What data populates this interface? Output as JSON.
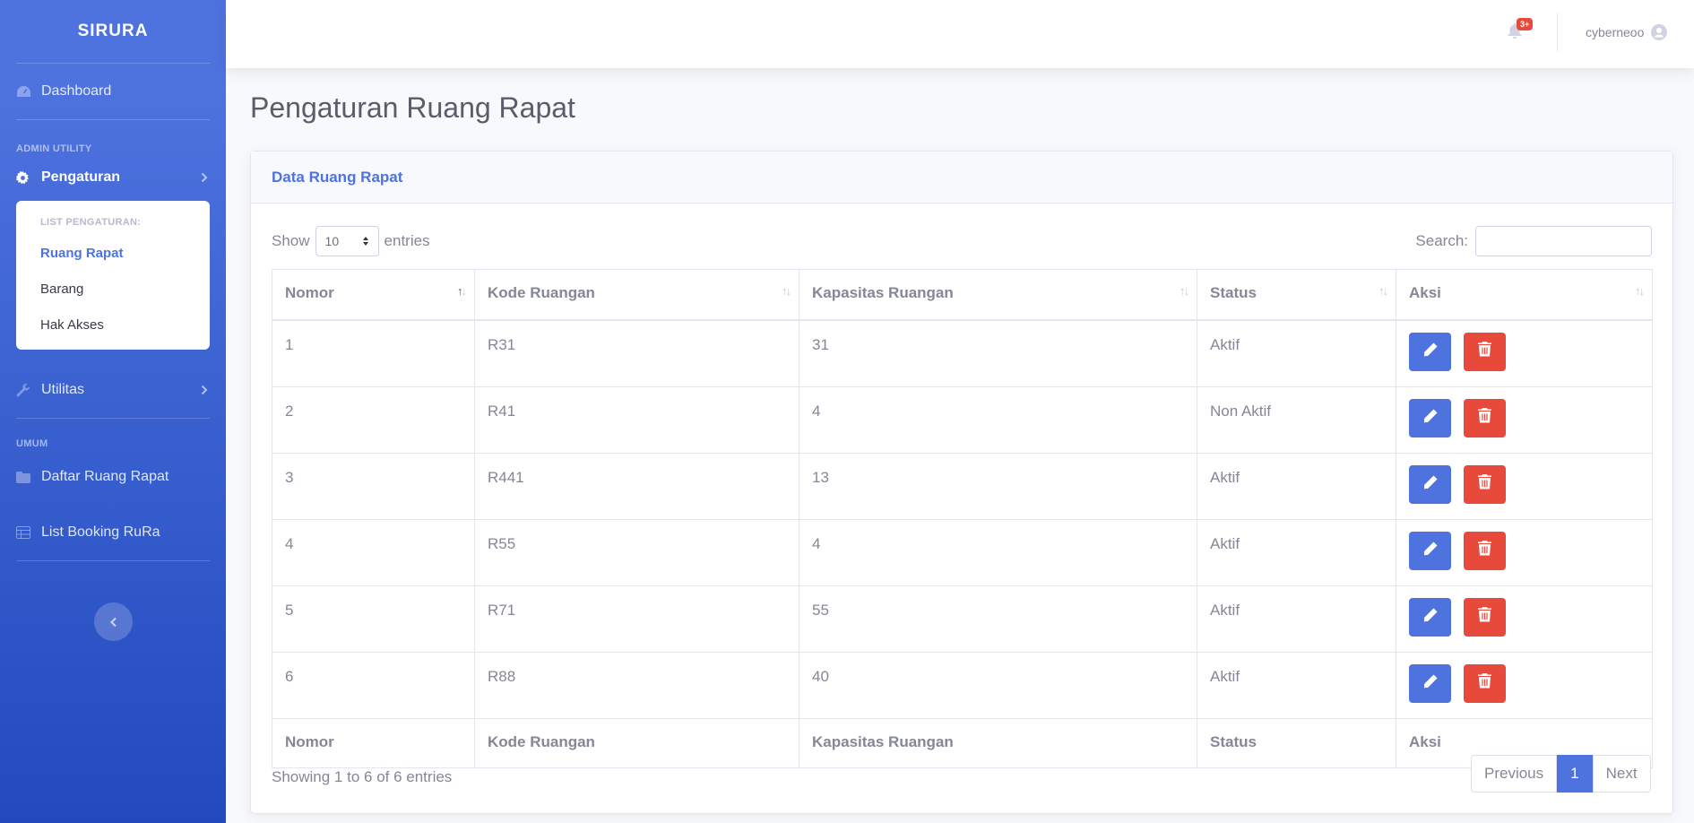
{
  "brand": "SIRURA",
  "sidebar": {
    "dashboard": "Dashboard",
    "heading_admin": "ADMIN UTILITY",
    "pengaturan": "Pengaturan",
    "collapse_heading": "LIST PENGATURAN:",
    "collapse_items": [
      "Ruang Rapat",
      "Barang",
      "Hak Akses"
    ],
    "utilitas": "Utilitas",
    "heading_umum": "UMUM",
    "daftar": "Daftar Ruang Rapat",
    "list_booking": "List Booking RuRa"
  },
  "topbar": {
    "badge": "3+",
    "username": "cyberneoo"
  },
  "page_title": "Pengaturan Ruang Rapat",
  "card": {
    "title": "Data Ruang Rapat",
    "show_label": "Show",
    "entries_value": "10",
    "entries_label": "entries",
    "search_label": "Search:",
    "columns": [
      "Nomor",
      "Kode Ruangan",
      "Kapasitas Ruangan",
      "Status",
      "Aksi"
    ],
    "rows": [
      {
        "nomor": "1",
        "kode": "R31",
        "kapasitas": "31",
        "status": "Aktif"
      },
      {
        "nomor": "2",
        "kode": "R41",
        "kapasitas": "4",
        "status": "Non Aktif"
      },
      {
        "nomor": "3",
        "kode": "R441",
        "kapasitas": "13",
        "status": "Aktif"
      },
      {
        "nomor": "4",
        "kode": "R55",
        "kapasitas": "4",
        "status": "Aktif"
      },
      {
        "nomor": "5",
        "kode": "R71",
        "kapasitas": "55",
        "status": "Aktif"
      },
      {
        "nomor": "6",
        "kode": "R88",
        "kapasitas": "40",
        "status": "Aktif"
      }
    ],
    "info": "Showing 1 to 6 of 6 entries",
    "pager": {
      "previous": "Previous",
      "current": "1",
      "next": "Next"
    }
  },
  "colors": {
    "primary": "#4e73df",
    "danger": "#e74a3b"
  }
}
